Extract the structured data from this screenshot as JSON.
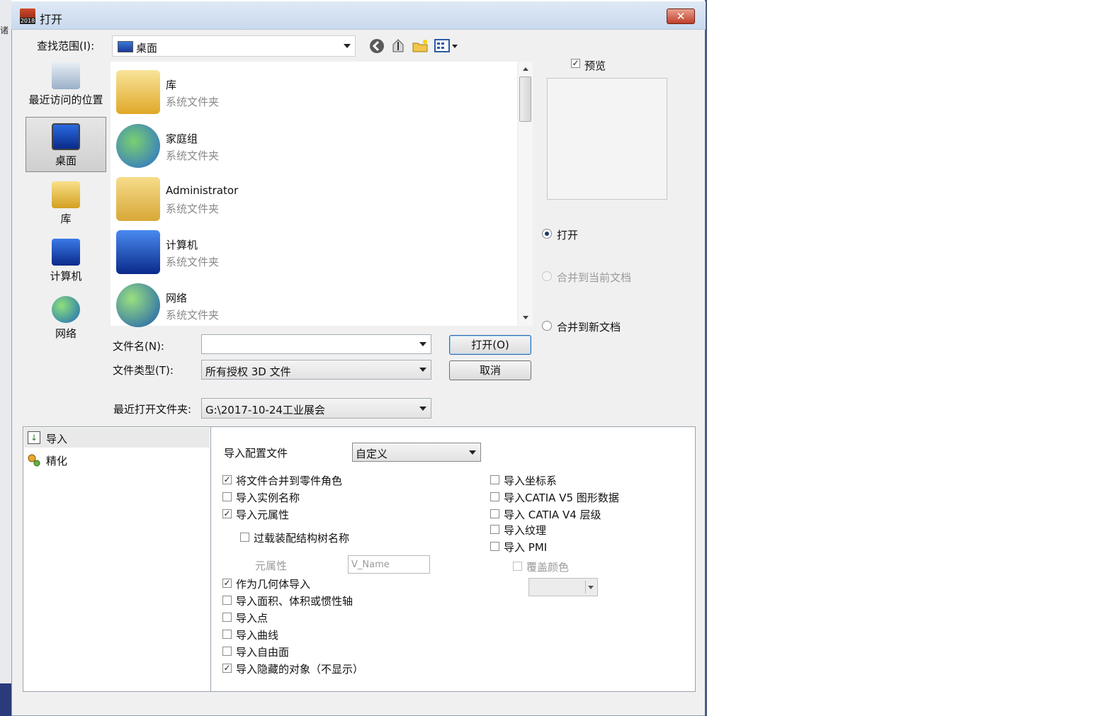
{
  "background": {
    "left_text": "诸"
  },
  "window": {
    "title": "打开",
    "title_icon": "2018",
    "close_icon": "✕"
  },
  "toolbar": {
    "lookin_label": "查找范围(I):",
    "lookin_value": "桌面",
    "back_icon": "back-arrow-icon",
    "up_icon": "up-folder-icon",
    "newfolder_icon": "new-folder-icon",
    "views_icon": "views-menu-icon"
  },
  "places": [
    {
      "label": "最近访问的位置"
    },
    {
      "label": "桌面"
    },
    {
      "label": "库"
    },
    {
      "label": "计算机"
    },
    {
      "label": "网络"
    }
  ],
  "files": [
    {
      "name": "库",
      "kind": "系统文件夹"
    },
    {
      "name": "家庭组",
      "kind": "系统文件夹"
    },
    {
      "name": "Administrator",
      "kind": "系统文件夹"
    },
    {
      "name": "计算机",
      "kind": "系统文件夹"
    },
    {
      "name": "网络",
      "kind": "系统文件夹"
    }
  ],
  "preview": {
    "label": "预览",
    "checked": true
  },
  "open_mode": {
    "open": "打开",
    "merge_current": "合并到当前文档",
    "merge_new": "合并到新文档"
  },
  "form": {
    "filename_label": "文件名(N):",
    "filename_value": "",
    "filetype_label": "文件类型(T):",
    "filetype_value": "所有授权 3D 文件",
    "open_button": "打开(O)",
    "cancel_button": "取消",
    "recent_label": "最近打开文件夹:",
    "recent_value": "G:\\2017-10-24工业展会"
  },
  "lower_nav": [
    {
      "label": "导入"
    },
    {
      "label": "精化"
    }
  ],
  "import": {
    "profile_label": "导入配置文件",
    "profile_value": "自定义",
    "left_options": [
      {
        "label": "将文件合并到零件角色",
        "checked": true
      },
      {
        "label": "导入实例名称",
        "checked": false
      },
      {
        "label": "导入元属性",
        "checked": true
      },
      {
        "label": "过载装配结构树名称",
        "checked": false
      },
      {
        "label": "作为几何体导入",
        "checked": true
      },
      {
        "label": "导入面积、体积或惯性轴",
        "checked": false
      },
      {
        "label": "导入点",
        "checked": false
      },
      {
        "label": "导入曲线",
        "checked": false
      },
      {
        "label": "导入自由面",
        "checked": false
      },
      {
        "label": "导入隐藏的对象（不显示）",
        "checked": true
      }
    ],
    "meta_label": "元属性",
    "meta_value": "V_Name",
    "right_options": [
      {
        "label": "导入坐标系",
        "checked": false
      },
      {
        "label": "导入CATIA V5 图形数据",
        "checked": false
      },
      {
        "label": "导入 CATIA V4 层级",
        "checked": false
      },
      {
        "label": "导入纹理",
        "checked": false
      },
      {
        "label": "导入 PMI",
        "checked": false
      },
      {
        "label": "覆盖颜色",
        "checked": false
      }
    ]
  },
  "colors": {
    "title_gradient_top": "#dfe9f5",
    "close_red": "#c0402a",
    "window_bg": "#f0f0f0"
  }
}
